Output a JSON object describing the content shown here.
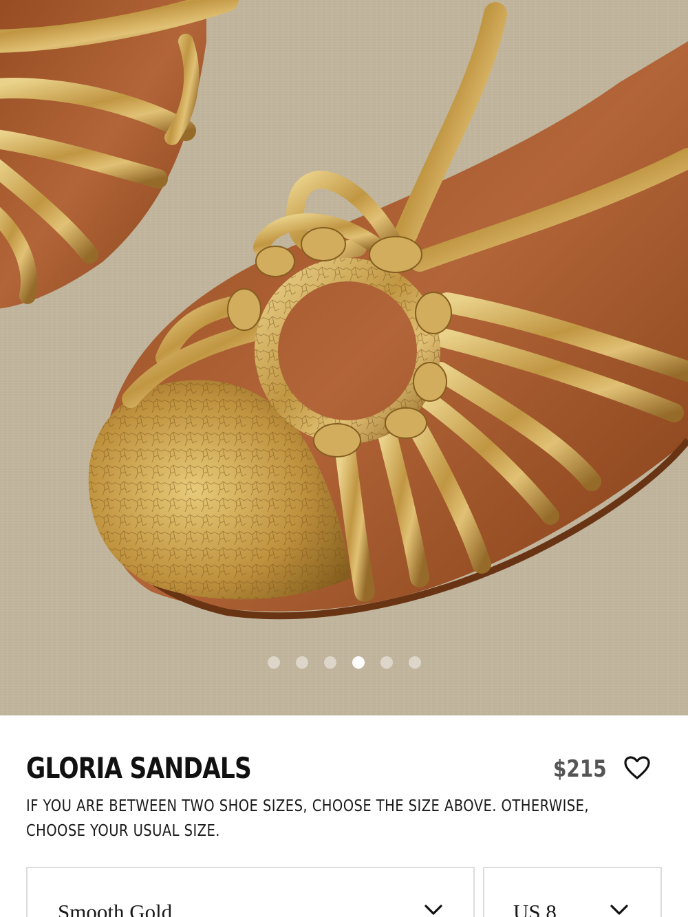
{
  "gallery": {
    "image_alt": "Gold crackled leather sandal close-up",
    "dots_count": 6,
    "active_dot": 3
  },
  "product": {
    "title": "GLORIA SANDALS",
    "price": "$215",
    "size_note": "IF YOU ARE BETWEEN TWO SHOE SIZES, CHOOSE THE SIZE ABOVE. OTHERWISE, CHOOSE YOUR USUAL SIZE.",
    "wishlist_icon": "heart-outline-icon"
  },
  "selectors": {
    "color": {
      "value": "Smooth Gold",
      "icon": "chevron-down-icon"
    },
    "size": {
      "value": "US 8",
      "icon": "chevron-down-icon"
    }
  },
  "colors": {
    "background": "#ffffff",
    "text": "#111111",
    "price": "#555555",
    "border": "#dcdcdc",
    "gold": "#c9a24a",
    "leather": "#a75a2c",
    "canvas": "#cbbfa8"
  }
}
